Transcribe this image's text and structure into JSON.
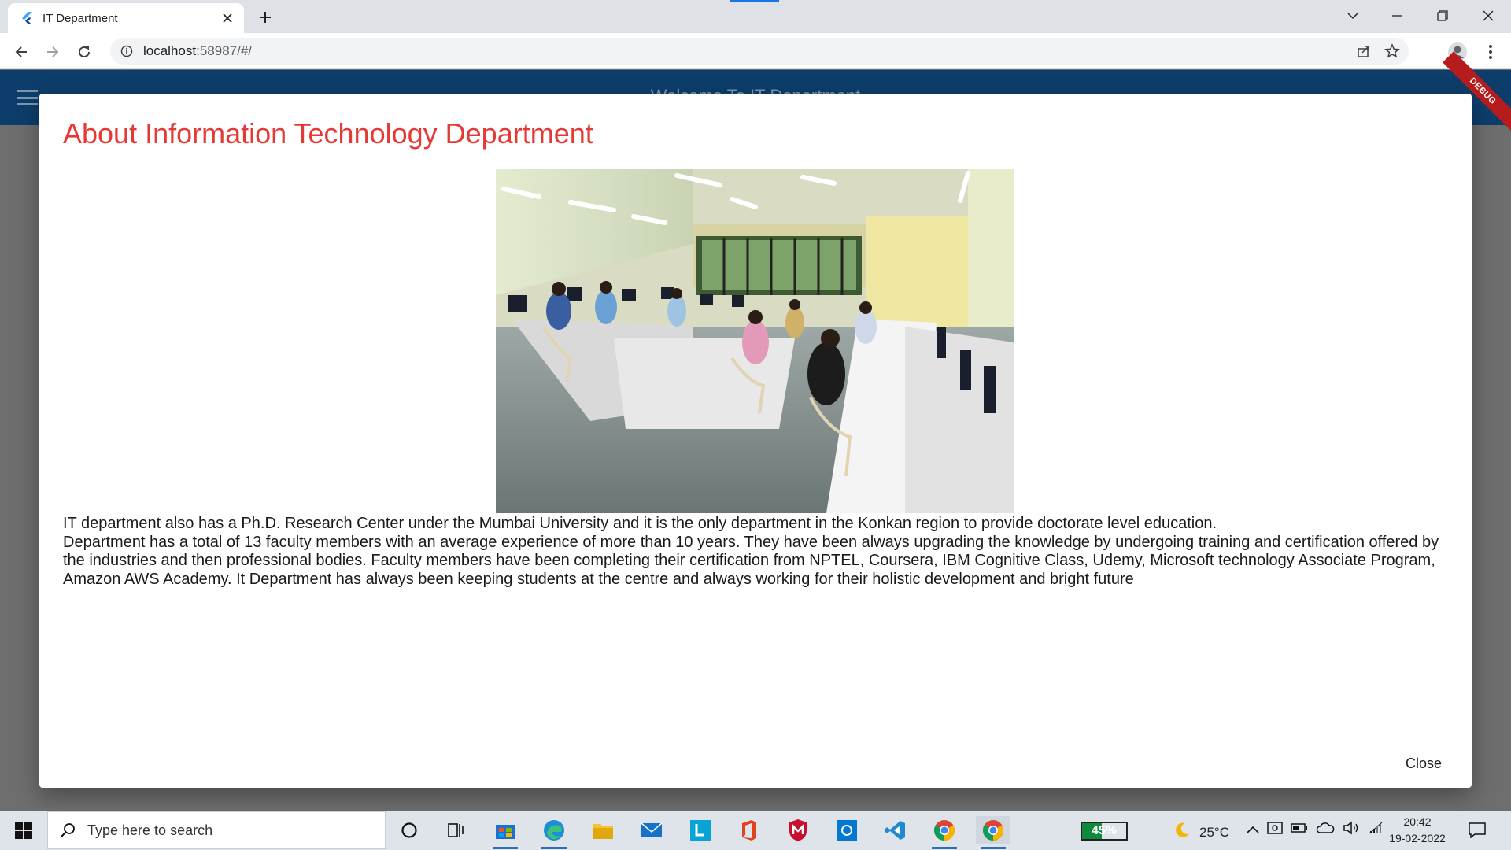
{
  "browser": {
    "tab_title": "IT Department",
    "url_host": "localhost",
    "url_rest": ":58987/#/",
    "icons": {
      "favicon": "flutter-icon",
      "close": "close-icon",
      "new_tab": "plus-icon",
      "tab_search": "chevron-down-icon",
      "back": "arrow-left-icon",
      "forward": "arrow-right-icon",
      "reload": "reload-icon",
      "site_info": "info-icon",
      "share": "share-icon",
      "bookmark": "star-icon",
      "profile": "profile-icon",
      "menu": "kebab-menu-icon"
    }
  },
  "app": {
    "title": "Welcome To IT Department",
    "debug_label": "DEBUG",
    "bar_color": "#0d3e6b"
  },
  "dialog": {
    "title": "About Information Technology Department",
    "title_color": "#e53935",
    "image_label": "computer-lab-photo",
    "paragraph_1": "IT department also has a Ph.D. Research Center under the Mumbai University and it is the only department in the Konkan region to provide doctorate level education.",
    "paragraph_2": "Department has a total of 13 faculty members with an average experience of more than 10 years. They have been always upgrading the knowledge by undergoing training and certification offered by the industries and then professional bodies. Faculty members have been completing their certification from NPTEL, Coursera, IBM Cognitive Class, Udemy, Microsoft technology Associate Program, Amazon AWS Academy. It Department has always been keeping students at the centre and always working for their holistic development and bright future",
    "close_label": "Close"
  },
  "taskbar": {
    "search_placeholder": "Type here to search",
    "battery_label": "45%",
    "battery_level": 0.45,
    "temperature": "25°C",
    "time": "20:42",
    "date": "19-02-2022",
    "icons": [
      "cortana-icon",
      "task-view-icon",
      "store-icon",
      "edge-icon",
      "file-explorer-icon",
      "mail-icon",
      "lens-icon",
      "office-icon",
      "mcafee-icon",
      "app-icon",
      "vscode-icon",
      "chrome-icon",
      "chrome-active-icon"
    ]
  }
}
